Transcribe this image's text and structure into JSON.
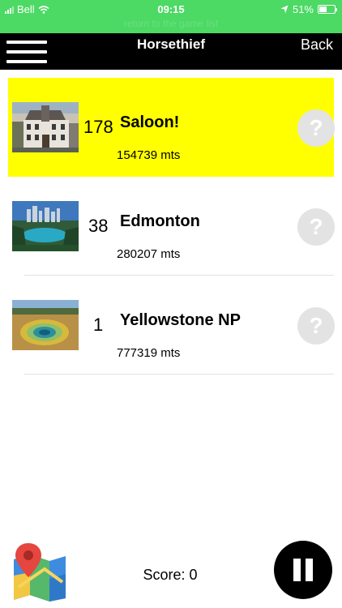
{
  "status_bar": {
    "carrier": "Bell",
    "time": "09:15",
    "battery": "51%",
    "battery_level": 0.51,
    "ghost_text": "return to the game list"
  },
  "nav": {
    "title": "Horsethief",
    "back_label": "Back",
    "menu_icon": "hamburger-menu-icon"
  },
  "destinations": [
    {
      "count": "178",
      "name": "Saloon!",
      "distance": "154739 mts",
      "highlighted": true,
      "image": "saloon-photo",
      "help": "?"
    },
    {
      "count": "38",
      "name": "Edmonton",
      "distance": "280207 mts",
      "highlighted": false,
      "image": "edmonton-skyline-photo",
      "help": "?"
    },
    {
      "count": "1",
      "name": "Yellowstone NP",
      "distance": "777319 mts",
      "highlighted": false,
      "image": "yellowstone-spring-photo",
      "help": "?"
    }
  ],
  "footer": {
    "score_label": "Score: 0",
    "map_icon": "map-pin-icon",
    "pause_icon": "pause-icon"
  },
  "colors": {
    "status_bar": "#4cd964",
    "nav_bar": "#000000",
    "highlight": "#ffff00",
    "help_button": "#e3e3e3"
  }
}
